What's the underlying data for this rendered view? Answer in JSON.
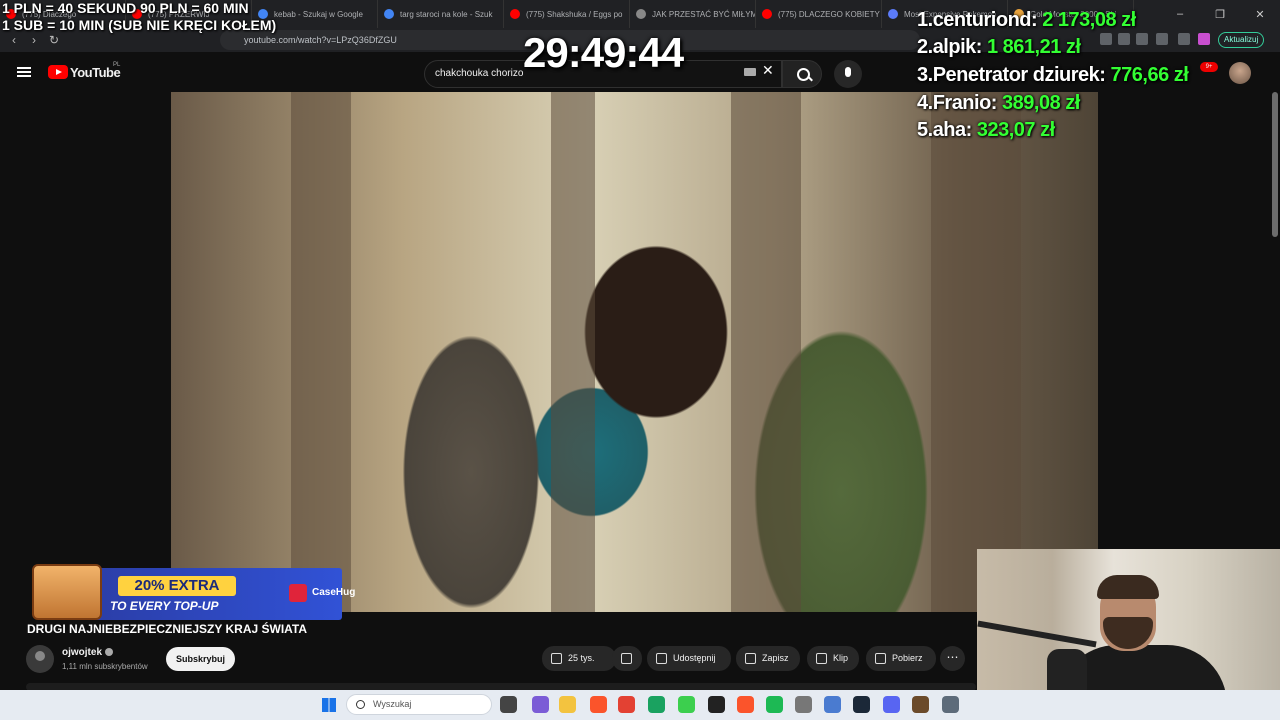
{
  "browser": {
    "tabs": [
      {
        "label": "(775) Dlaczego",
        "color": "#ff0000"
      },
      {
        "label": "(775) PRZERWIJ",
        "color": "#ff0000"
      },
      {
        "label": "kebab - Szukaj w Google",
        "color": "#4285f4"
      },
      {
        "label": "targ staroci na kole - Szuk",
        "color": "#4285f4"
      },
      {
        "label": "(775) Shakshuka / Eggs po",
        "color": "#ff0000"
      },
      {
        "label": "JAK PRZESTAĆ BYĆ MIŁYM",
        "color": "#888888"
      },
      {
        "label": "(775) DLACZEGO KOBIETY",
        "color": "#ff0000"
      },
      {
        "label": "Most Expensive Pokemon",
        "color": "#5c7cfa"
      },
      {
        "label": "Gold Monster 2000 - Ski",
        "color": "#e8a33d"
      }
    ],
    "url": "youtube.com/watch?v=LPzQ36DfZGU",
    "update_label": "Aktualizuj"
  },
  "youtube": {
    "logo_text": "YouTube",
    "country_code": "PL",
    "search_value": "chakchouka chorizo",
    "notif_count": "9+",
    "video_title": "DRUGI NAJNIEBEZPIECZNIEJSZY KRAJ ŚWIATA",
    "channel_name": "ojwojtek",
    "channel_subs": "1,11 mln subskrybentów",
    "subscribe_label": "Subskrybuj",
    "like_count": "25 tys.",
    "actions": {
      "share": "Udostępnij",
      "save": "Zapisz",
      "clip": "Klip",
      "download": "Pobierz"
    }
  },
  "stream_overlay": {
    "rules_line1": "1 PLN = 40 SEKUND 90 PLN = 60 MIN",
    "rules_line2": "1 SUB = 10 MIN (SUB NIE KRĘCI KOŁEM)",
    "timer": "29:49:44",
    "leaderboard": [
      {
        "rank": "1.",
        "name": "centuriond:",
        "amount": "2 173,08 zł"
      },
      {
        "rank": "2.",
        "name": "alpik:",
        "amount": "1 861,21 zł"
      },
      {
        "rank": "3.",
        "name": "Penetrator dziurek:",
        "amount": "776,66 zł"
      },
      {
        "rank": "4.",
        "name": "Franio:",
        "amount": "389,08 zł"
      },
      {
        "rank": "5.",
        "name": "aha:",
        "amount": "323,07 zł"
      }
    ],
    "ad_line1": "20% EXTRA",
    "ad_line2": "TO EVERY TOP-UP",
    "ad_brand": "CaseHug"
  },
  "taskbar": {
    "search_placeholder": "Wyszukaj"
  }
}
